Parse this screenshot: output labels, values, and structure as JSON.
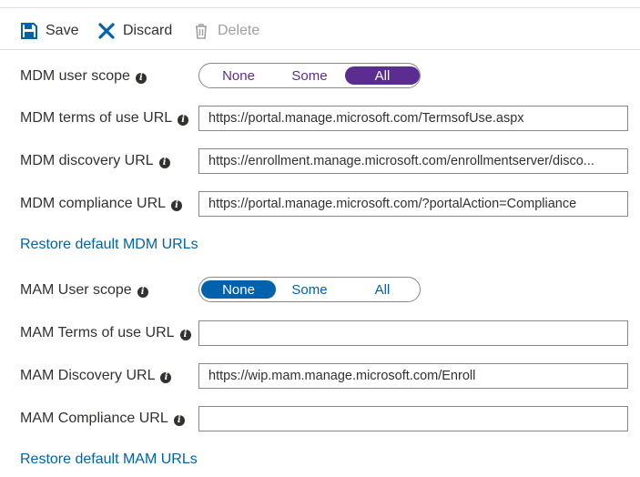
{
  "toolbar": {
    "save_label": "Save",
    "discard_label": "Discard",
    "delete_label": "Delete"
  },
  "mdm": {
    "user_scope_label": "MDM user scope",
    "scope_options": [
      "None",
      "Some",
      "All"
    ],
    "scope_selected": "All",
    "terms_label": "MDM terms of use URL",
    "terms_value": "https://portal.manage.microsoft.com/TermsofUse.aspx",
    "discovery_label": "MDM discovery URL",
    "discovery_value": "https://enrollment.manage.microsoft.com/enrollmentserver/disco...",
    "compliance_label": "MDM compliance URL",
    "compliance_value": "https://portal.manage.microsoft.com/?portalAction=Compliance",
    "restore_link": "Restore default MDM URLs"
  },
  "mam": {
    "user_scope_label": "MAM User scope",
    "scope_options": [
      "None",
      "Some",
      "All"
    ],
    "scope_selected": "None",
    "terms_label": "MAM Terms of use URL",
    "terms_value": "",
    "discovery_label": "MAM Discovery URL",
    "discovery_value": "https://wip.mam.manage.microsoft.com/Enroll",
    "compliance_label": "MAM Compliance URL",
    "compliance_value": "",
    "restore_link": "Restore default MAM URLs"
  },
  "colors": {
    "mdm_accent": "#5c2d91",
    "mam_accent": "#0062ad",
    "link": "#0062ad"
  },
  "icons": {
    "save": "save-icon",
    "discard": "close-icon",
    "delete": "trash-icon",
    "info": "info-icon"
  }
}
